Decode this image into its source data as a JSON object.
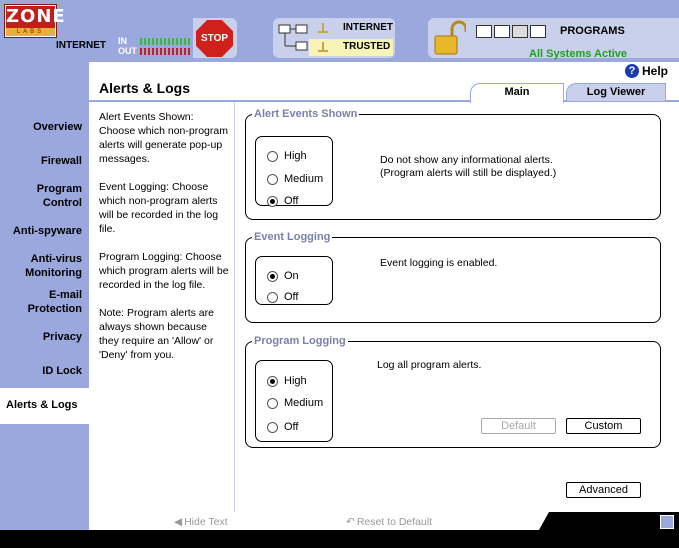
{
  "topbar": {
    "logo_top": "ZONE",
    "logo_bottom": "LABS",
    "internet_label": "INTERNET",
    "meter_in": "IN",
    "meter_out": "OUT",
    "stop_label": "STOP",
    "zone_internet": "INTERNET",
    "zone_trusted": "TRUSTED",
    "programs_label": "PROGRAMS",
    "status": "All Systems Active",
    "status_color": "#1ba31b"
  },
  "sidebar": {
    "items": [
      {
        "label": "Overview"
      },
      {
        "label": "Firewall"
      },
      {
        "label": "Program Control"
      },
      {
        "label": "Anti-spyware"
      },
      {
        "label": "Anti-virus Monitoring"
      },
      {
        "label": "E-mail Protection"
      },
      {
        "label": "Privacy"
      },
      {
        "label": "ID Lock"
      },
      {
        "label": "Alerts & Logs"
      }
    ],
    "active_index": 8
  },
  "main": {
    "title": "Alerts & Logs",
    "help_label": "Help",
    "tabs": [
      {
        "label": "Main",
        "active": true
      },
      {
        "label": "Log Viewer",
        "active": false
      }
    ],
    "description": [
      "Alert Events Shown: Choose which non-program alerts will generate pop-up messages.",
      "Event Logging: Choose which non-program alerts will be recorded in the log file.",
      "Program Logging: Choose which program alerts will be recorded in the log file.",
      "Note: Program alerts are always shown because they require an 'Allow' or 'Deny' from you."
    ],
    "alert_events": {
      "legend": "Alert Events Shown",
      "options": [
        "High",
        "Medium",
        "Off"
      ],
      "selected": "Off",
      "message_line1": "Do not show any informational alerts.",
      "message_line2": "(Program alerts will still be displayed.)"
    },
    "event_logging": {
      "legend": "Event Logging",
      "options": [
        "On",
        "Off"
      ],
      "selected": "On",
      "message": "Event logging is enabled."
    },
    "program_logging": {
      "legend": "Program Logging",
      "options": [
        "High",
        "Medium",
        "Off"
      ],
      "selected": "High",
      "message": "Log all program alerts.",
      "default_button": "Default",
      "custom_button": "Custom"
    },
    "advanced_button": "Advanced"
  },
  "bottombar": {
    "hide_text": "Hide Text",
    "reset_default": "Reset to Default"
  },
  "colors": {
    "sidebar_bg": "#9aa8de",
    "panel_bg": "#c9d0ec",
    "legend_text": "#7b80a8",
    "stop_red": "#d0201b"
  }
}
